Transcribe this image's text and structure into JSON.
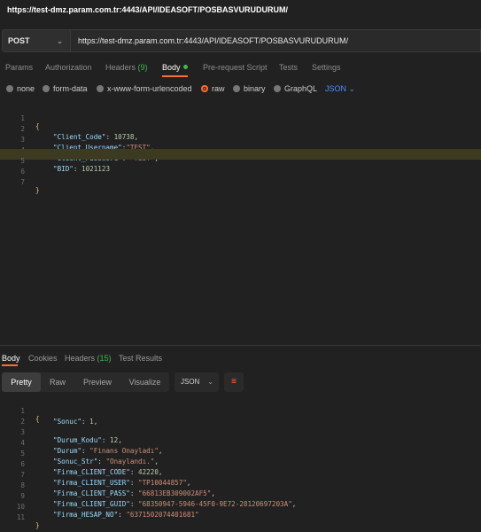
{
  "title_url": "https://test-dmz.param.com.tr:4443/API/IDEASOFT/POSBASVURUDURUM/",
  "request": {
    "method": "POST",
    "url": "https://test-dmz.param.com.tr:4443/API/IDEASOFT/POSBASVURUDURUM/"
  },
  "request_tabs": {
    "params": "Params",
    "authorization": "Authorization",
    "headers": "Headers",
    "headers_count": "(9)",
    "body": "Body",
    "prerequest": "Pre-request Script",
    "tests": "Tests",
    "settings": "Settings"
  },
  "body_types": {
    "none": "none",
    "form_data": "form-data",
    "urlencoded": "x-www-form-urlencoded",
    "raw": "raw",
    "binary": "binary",
    "graphql": "GraphQL",
    "selected_format": "JSON"
  },
  "request_body": {
    "line_numbers": [
      "1",
      "2",
      "3",
      "4",
      "5",
      "6",
      "7"
    ],
    "open": "{",
    "close": "}",
    "k1": "\"Client_Code\"",
    "v1": "10738",
    "k2": "\"Client_Username\"",
    "v2": "\"TEST\"",
    "k3": "\"Client_Password\"",
    "v3": "\"TEST\"",
    "k4": "\"BID\"",
    "v4": "1021123"
  },
  "response_tabs": {
    "body": "Body",
    "cookies": "Cookies",
    "headers": "Headers",
    "headers_count": "(15)",
    "test_results": "Test Results"
  },
  "view_modes": {
    "pretty": "Pretty",
    "raw": "Raw",
    "preview": "Preview",
    "visualize": "Visualize",
    "format": "JSON"
  },
  "response_body": {
    "line_numbers": [
      "1",
      "2",
      "3",
      "4",
      "5",
      "6",
      "7",
      "8",
      "9",
      "10",
      "11"
    ],
    "open": "{",
    "close": "}",
    "k1": "\"Sonuc\"",
    "v1": "1",
    "k2": "\"Durum_Kodu\"",
    "v2": "12",
    "k3": "\"Durum\"",
    "v3": "\"Finans Onayladı\"",
    "k4": "\"Sonuc_Str\"",
    "v4": "\"Onaylandı.\"",
    "k5": "\"Firma_CLIENT_CODE\"",
    "v5": "42220",
    "k6": "\"Firma_CLIENT_USER\"",
    "v6": "\"TP10044857\"",
    "k7": "\"Firma_CLIENT_PASS\"",
    "v7": "\"66813EB309002AF5\"",
    "k8": "\"Firma_CLIENT_GUID\"",
    "v8": "\"68350947-5946-45F0-9E72-28120697203A\"",
    "k9": "\"Firma_HESAP_NO\"",
    "v9": "\"6371502074401681\""
  },
  "icons": {
    "method_dropdown": "chevron-down-icon",
    "format_dropdown": "chevron-down-icon",
    "wrap": "wrap-lines-icon"
  }
}
